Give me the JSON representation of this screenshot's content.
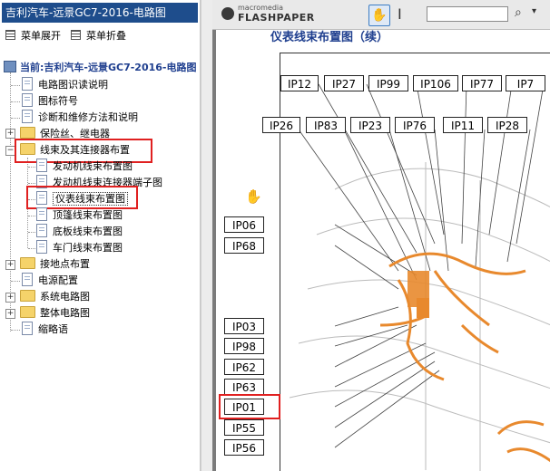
{
  "left_pane": {
    "title": "吉利汽车-远景GC7-2016-电路图",
    "expand_all": "菜单展开",
    "collapse_all": "菜单折叠",
    "root": "当前:吉利汽车-远景GC7-2016-电路图",
    "items": [
      {
        "label": "电路图识读说明",
        "type": "doc"
      },
      {
        "label": "图标符号",
        "type": "doc"
      },
      {
        "label": "诊断和维修方法和说明",
        "type": "doc"
      },
      {
        "label": "保险丝、继电器",
        "type": "folder",
        "expander": "+"
      },
      {
        "label": "线束及其连接器布置",
        "type": "folder",
        "expander": "−"
      },
      {
        "label": "发动机线束布置图",
        "type": "doc"
      },
      {
        "label": "发动机线束连接器端子图",
        "type": "doc"
      },
      {
        "label": "仪表线束布置图",
        "type": "doc"
      },
      {
        "label": "顶篷线束布置图",
        "type": "doc"
      },
      {
        "label": "底板线束布置图",
        "type": "doc"
      },
      {
        "label": "车门线束布置图",
        "type": "doc"
      },
      {
        "label": "接地点布置",
        "type": "folder",
        "expander": "+"
      },
      {
        "label": "电源配置",
        "type": "doc"
      },
      {
        "label": "系统电路图",
        "type": "folder",
        "expander": "+"
      },
      {
        "label": "整体电路图",
        "type": "folder",
        "expander": "+"
      },
      {
        "label": "缩略语",
        "type": "doc"
      }
    ]
  },
  "viewer": {
    "logo_top": "macromedia",
    "logo_bottom": "FLASHPAPER",
    "hand_tool": "✋",
    "text_tool": "I",
    "search_placeholder": "",
    "search_icon": "⌕",
    "dropdown_icon": "▾",
    "page_title": "仪表线束布置图（续）",
    "connector_labels_top": [
      "IP12",
      "IP27",
      "IP99",
      "IP106",
      "IP77",
      "IP7"
    ],
    "connector_labels_row2": [
      "IP26",
      "IP83",
      "IP23",
      "IP76",
      "IP11",
      "IP28"
    ],
    "connector_labels_left": [
      "IP06",
      "IP68",
      "IP03",
      "IP98",
      "IP62",
      "IP63",
      "IP01",
      "IP55",
      "IP56"
    ]
  },
  "colors": {
    "title_bar": "#1e4d8c",
    "highlight_box": "#e02020",
    "harness": "#e8892d",
    "page_title": "#1f3f8f"
  }
}
